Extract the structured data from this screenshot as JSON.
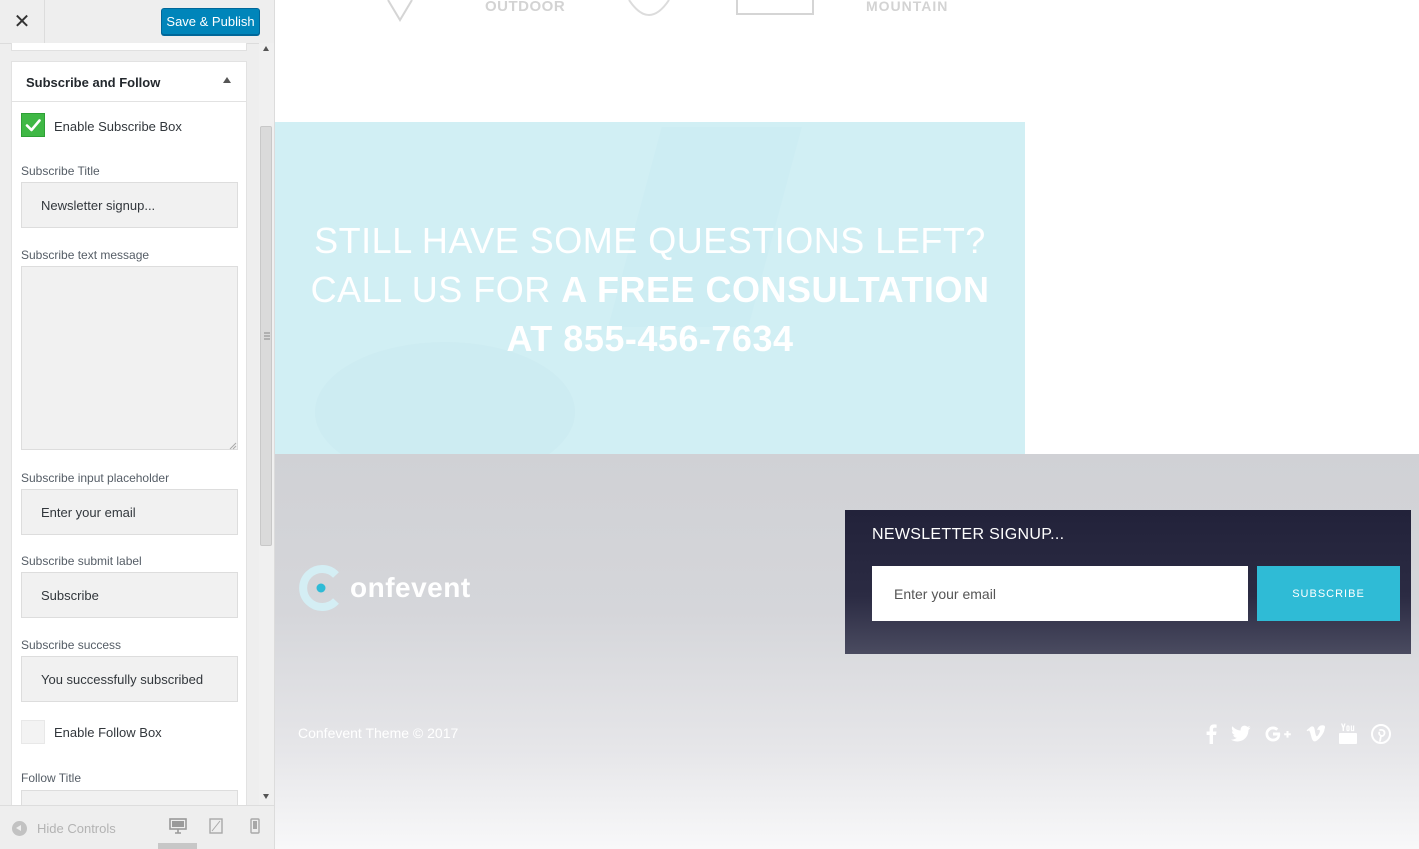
{
  "header": {
    "close_icon": "close-icon",
    "publish_label": "Save & Publish"
  },
  "section": {
    "title": "Subscribe and Follow",
    "enable_subscribe": {
      "label": "Enable Subscribe Box",
      "checked": true
    },
    "subscribe_title": {
      "label": "Subscribe Title",
      "value": "Newsletter signup..."
    },
    "subscribe_text": {
      "label": "Subscribe text message",
      "value": ""
    },
    "subscribe_placeholder": {
      "label": "Subscribe input placeholder",
      "value": "Enter your email"
    },
    "subscribe_submit": {
      "label": "Subscribe submit label",
      "value": "Subscribe"
    },
    "subscribe_success": {
      "label": "Subscribe success",
      "value": "You successfully subscribed"
    },
    "enable_follow": {
      "label": "Enable Follow Box",
      "checked": false
    },
    "follow_title": {
      "label": "Follow Title"
    }
  },
  "footer_bar": {
    "hide_controls": "Hide Controls",
    "devices": [
      "desktop-icon",
      "tablet-icon",
      "mobile-icon"
    ],
    "active_device": "desktop"
  },
  "preview": {
    "brands": [
      "OUTDOOR",
      "MOUNTAIN"
    ],
    "cta": {
      "line1": "STILL HAVE SOME QUESTIONS LEFT?",
      "line2_light": "CALL US FOR ",
      "line2_bold": "A FREE CONSULTATION",
      "line3": "AT 855-456-7634"
    },
    "logo_text": "onfevent",
    "newsletter": {
      "title": "NEWSLETTER SIGNUP...",
      "placeholder": "Enter your email",
      "button": "SUBSCRIBE"
    },
    "copyright": "Confevent Theme © 2017",
    "socials": [
      "facebook-icon",
      "twitter-icon",
      "google-plus-icon",
      "vimeo-icon",
      "youtube-icon",
      "pinterest-icon"
    ]
  },
  "colors": {
    "publish": "#0085ba",
    "checkbox_on": "#3fb845",
    "cta_bg": "#d1eff4",
    "newsletter_bg": "#22223a",
    "subscribe_button": "#2fbbd6"
  }
}
